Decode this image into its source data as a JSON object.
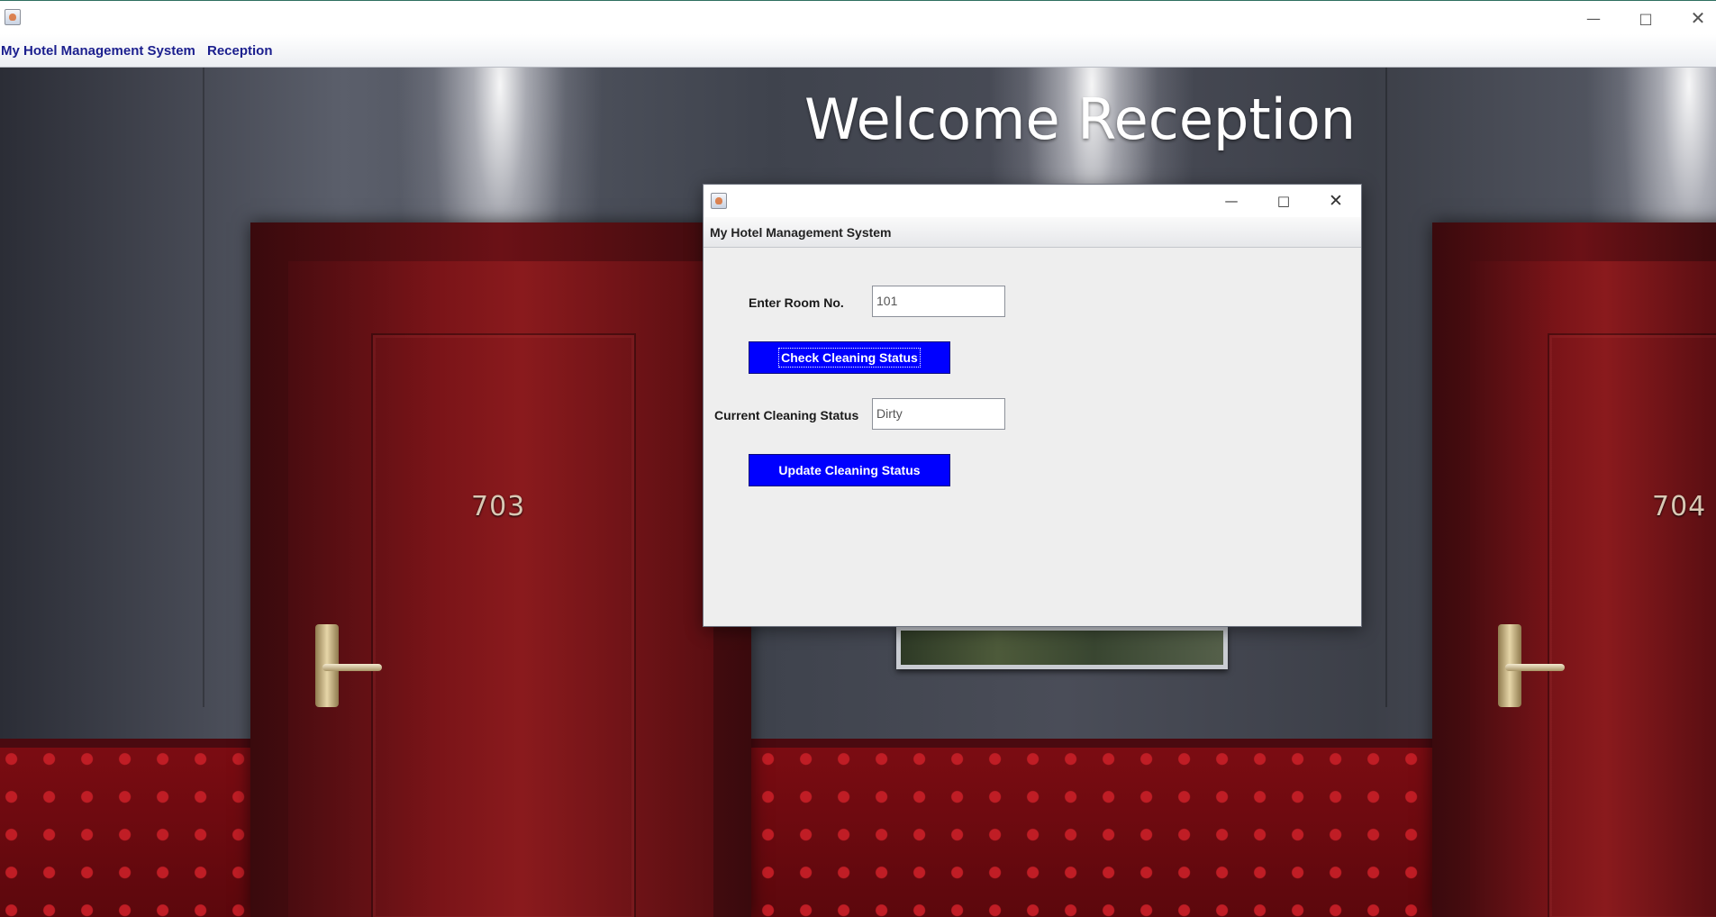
{
  "window": {
    "minimize_icon": "minimize-icon",
    "maximize_icon": "maximize-icon",
    "close_icon": "close-icon"
  },
  "menubar": {
    "items": [
      {
        "label": "My Hotel Management System"
      },
      {
        "label": "Reception"
      }
    ]
  },
  "scene": {
    "heading": "Welcome Reception",
    "door_left_number": "703",
    "door_right_number": "704"
  },
  "dialog": {
    "menu_title": "My Hotel Management System",
    "room_label": "Enter Room No.",
    "room_value": "101",
    "check_button": "Check Cleaning Status",
    "status_label": "Current Cleaning Status",
    "status_value": "Dirty",
    "update_button": "Update Cleaning Status"
  },
  "colors": {
    "button_bg": "#0000ff",
    "menu_text": "#1b1f8e"
  }
}
